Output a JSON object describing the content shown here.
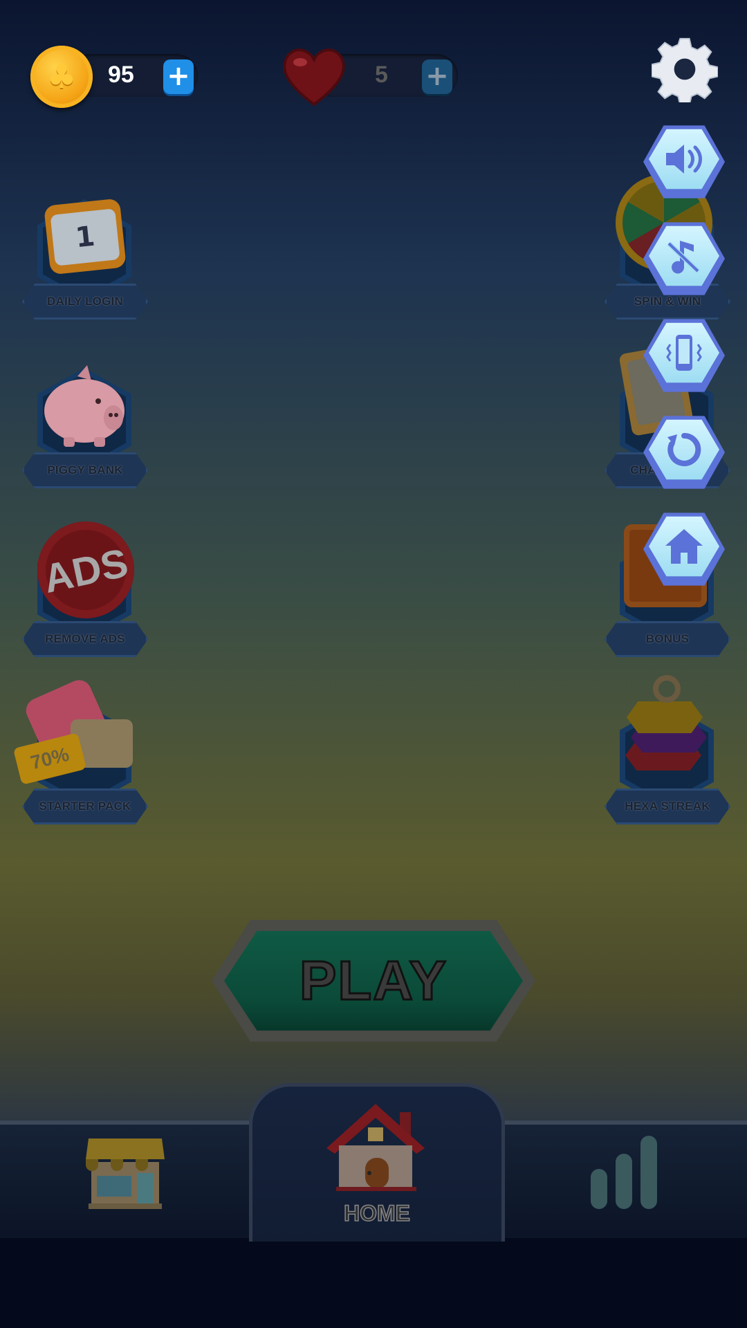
{
  "currency": {
    "coins": "95",
    "lives": "5",
    "plus": "+"
  },
  "left_items": [
    {
      "label": "DAILY LOGIN",
      "icon": "calendar-icon"
    },
    {
      "label": "PIGGY BANK",
      "icon": "piggy-bank-icon"
    },
    {
      "label": "REMOVE ADS",
      "icon": "remove-ads-icon"
    },
    {
      "label": "STARTER PACK",
      "icon": "starter-pack-icon"
    }
  ],
  "right_items": [
    {
      "label": "SPIN & WIN",
      "icon": "wheel-icon"
    },
    {
      "label": "CHALLENGE",
      "icon": "challenge-icon"
    },
    {
      "label": "BONUS",
      "icon": "bonus-box-icon"
    },
    {
      "label": "HEXA STREAK",
      "icon": "hexa-stack-icon"
    }
  ],
  "settings_menu": [
    "sound-icon",
    "music-off-icon",
    "vibration-icon",
    "restart-icon",
    "home-icon"
  ],
  "calendar_day": "1",
  "ads_text": "ADS",
  "discount": "70%",
  "play_label": "PLAY",
  "nav": {
    "shop_icon": "shop-icon",
    "home_label": "HOME",
    "leaderboard_icon": "leaderboard-icon"
  },
  "colors": {
    "coin": "#f5a416",
    "plus": "#1f8fe8",
    "settings_button": "#9cdcf2",
    "play_button": "#0b4a38"
  }
}
